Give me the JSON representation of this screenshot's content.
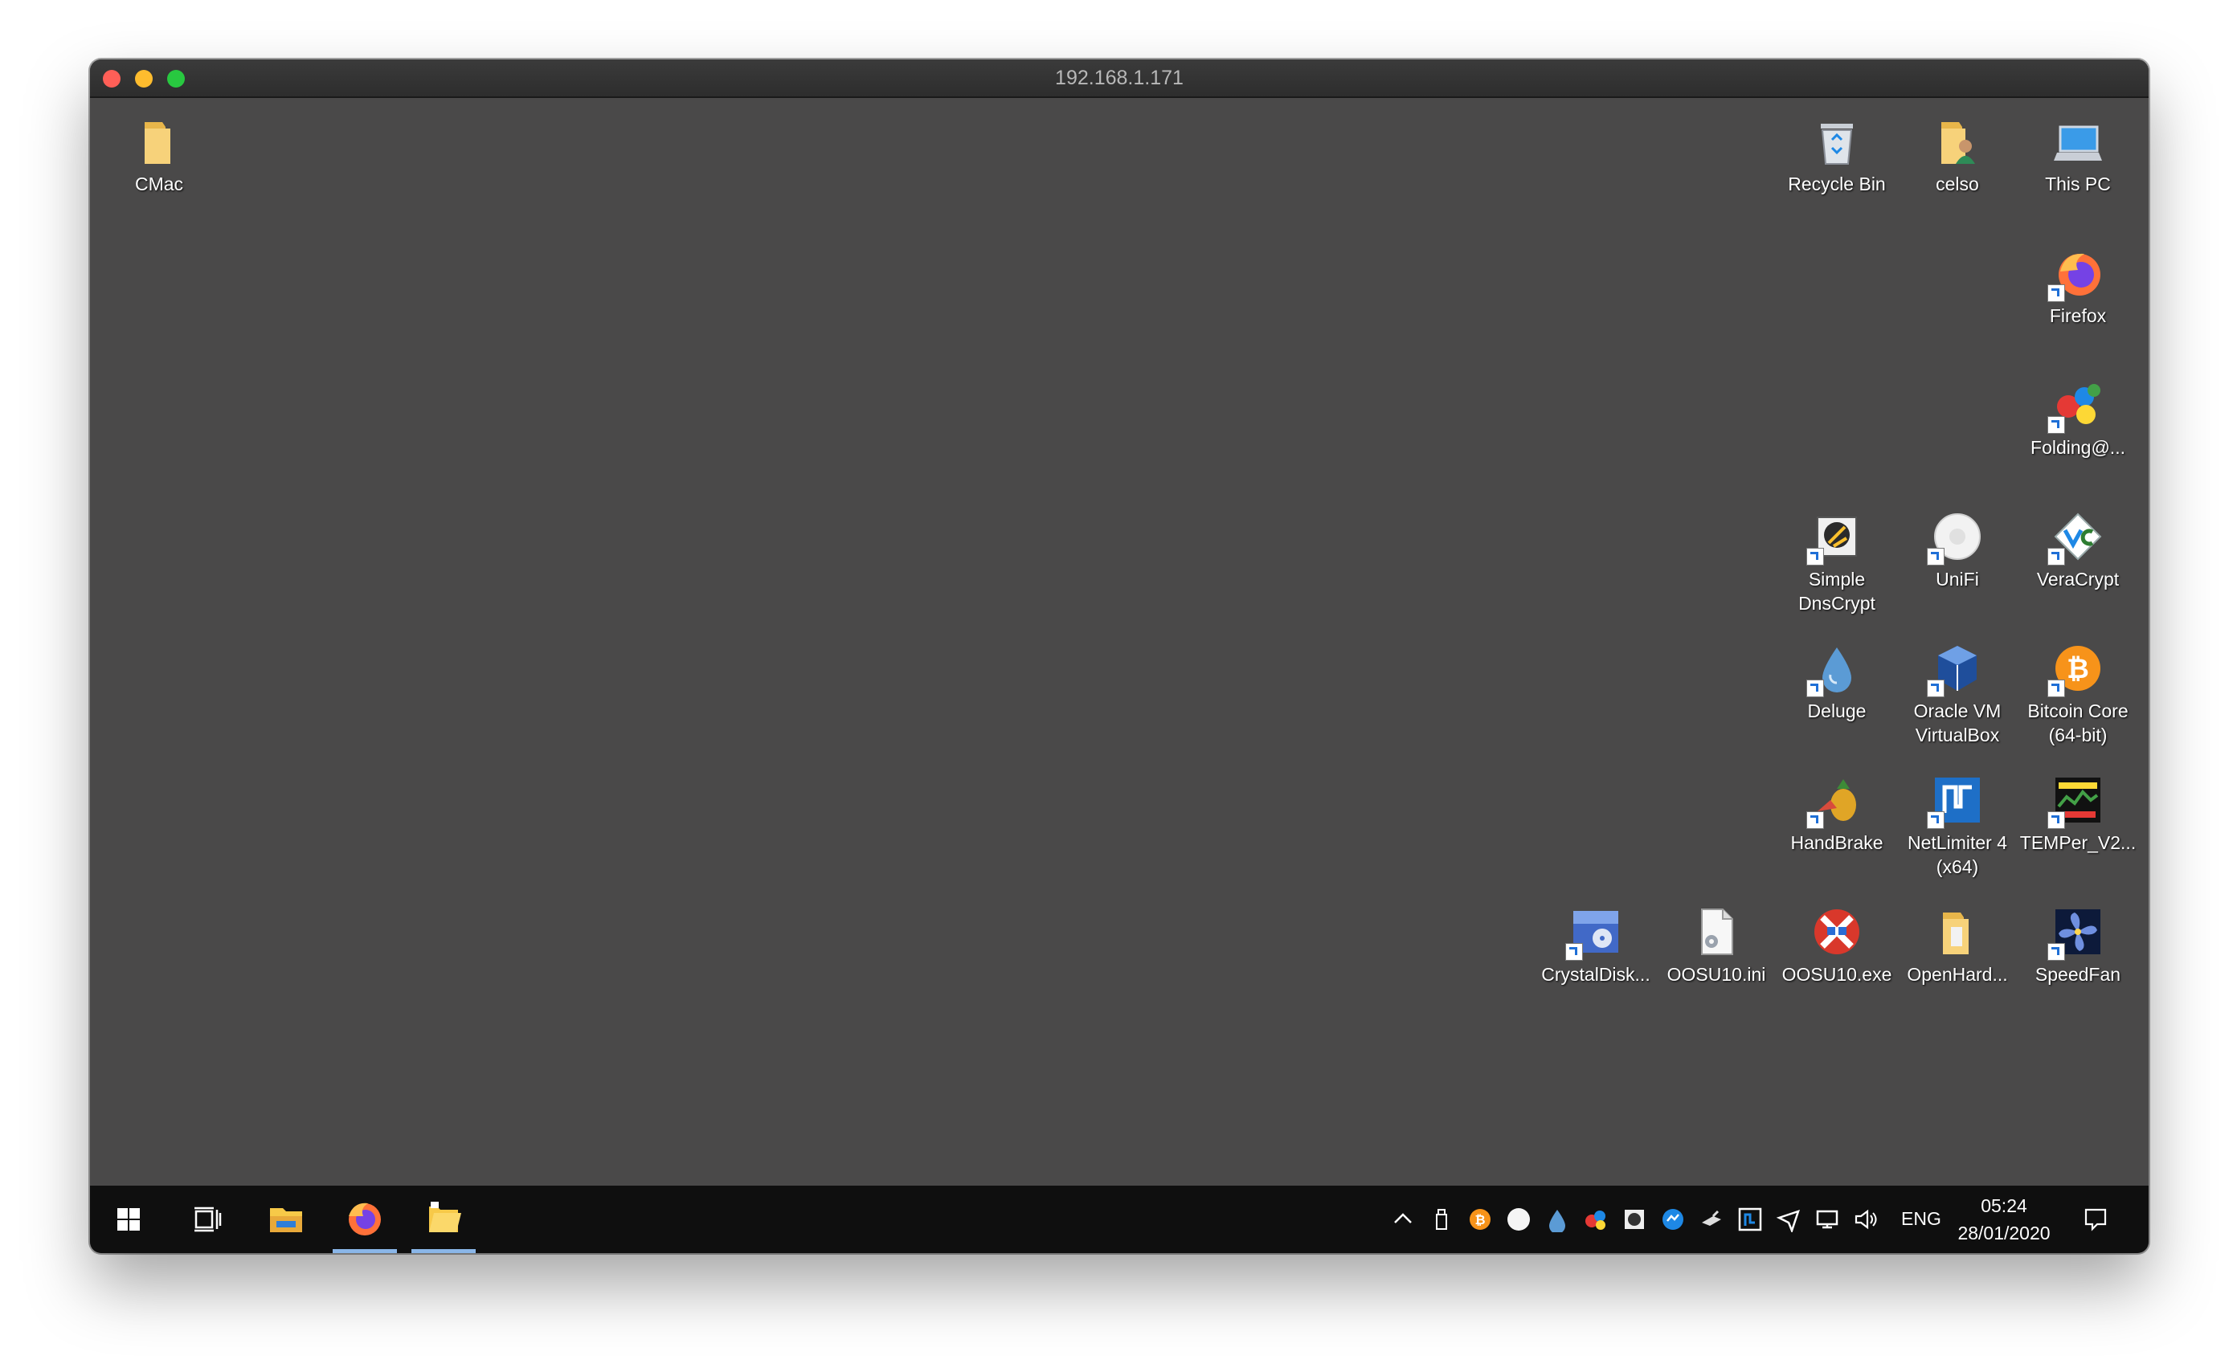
{
  "window": {
    "title": "192.168.1.171",
    "traffic_lights": [
      "#ff5f57",
      "#febc2e",
      "#28c840"
    ]
  },
  "desktop": {
    "background": "#4a4949",
    "icons": [
      {
        "label": "CMac",
        "icon": "folder-icon"
      },
      {
        "label": "Recycle Bin",
        "icon": "recycle-bin-icon"
      },
      {
        "label": "celso",
        "icon": "user-folder-icon"
      },
      {
        "label": "This PC",
        "icon": "computer-icon"
      },
      {
        "label": "Firefox",
        "icon": "firefox-icon"
      },
      {
        "label": "Folding@...",
        "icon": "folding-at-home-icon"
      },
      {
        "label": "Simple DnsCrypt",
        "icon": "simplednscrypt-icon"
      },
      {
        "label": "UniFi",
        "icon": "unifi-icon"
      },
      {
        "label": "VeraCrypt",
        "icon": "veracrypt-icon"
      },
      {
        "label": "Deluge",
        "icon": "deluge-icon"
      },
      {
        "label": "Oracle VM VirtualBox",
        "icon": "virtualbox-icon"
      },
      {
        "label": "Bitcoin Core (64-bit)",
        "icon": "bitcoin-icon"
      },
      {
        "label": "HandBrake",
        "icon": "handbrake-icon"
      },
      {
        "label": "NetLimiter 4 (x64)",
        "icon": "netlimiter-icon"
      },
      {
        "label": "TEMPer_V2...",
        "icon": "temper-icon"
      },
      {
        "label": "CrystalDisk...",
        "icon": "crystaldisk-icon"
      },
      {
        "label": "OOSU10.ini",
        "icon": "ini-file-icon"
      },
      {
        "label": "OOSU10.exe",
        "icon": "oosu10-icon"
      },
      {
        "label": "OpenHard...",
        "icon": "openhardware-folder-icon"
      },
      {
        "label": "SpeedFan",
        "icon": "speedfan-icon"
      }
    ]
  },
  "taskbar": {
    "buttons": [
      {
        "name": "start-button",
        "icon": "windows-logo-icon"
      },
      {
        "name": "task-view-button",
        "icon": "task-view-icon"
      },
      {
        "name": "file-explorer-button",
        "icon": "file-explorer-icon"
      },
      {
        "name": "firefox-taskbar-button",
        "icon": "firefox-icon",
        "active": true
      },
      {
        "name": "folder-app-taskbar-button",
        "icon": "folder-app-icon",
        "active": true
      }
    ],
    "tray": {
      "icons": [
        "chevron-up-icon",
        "usb-drive-icon",
        "bitcoin-icon",
        "unifi-icon",
        "deluge-icon",
        "folding-icon",
        "simplednscrypt-icon",
        "netlimiter-monitor-icon",
        "usb-device-icon",
        "netlimiter-icon",
        "airplane-icon",
        "network-icon",
        "volume-icon"
      ],
      "language": "ENG",
      "time": "05:24",
      "date": "28/01/2020"
    }
  }
}
